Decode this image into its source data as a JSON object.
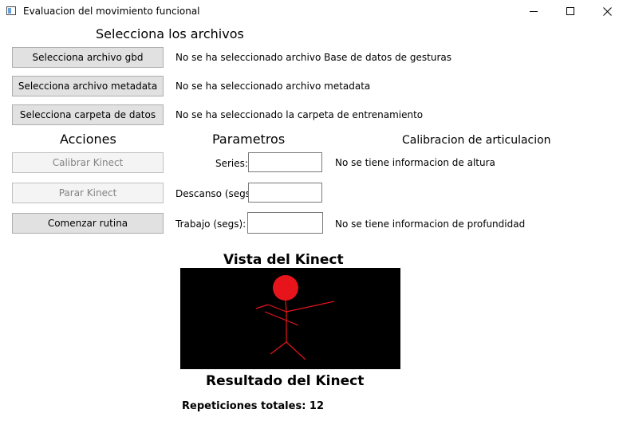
{
  "window": {
    "title": "Evaluacion del movimiento funcional"
  },
  "files": {
    "heading": "Selecciona los archivos",
    "gbd_button": "Selecciona archivo gbd",
    "gbd_status": "No se ha seleccionado archivo Base de datos de gesturas",
    "metadata_button": "Selecciona archivo metadata",
    "metadata_status": "No se ha seleccionado archivo metadata",
    "folder_button": "Selecciona carpeta de datos",
    "folder_status": "No se ha seleccionado la carpeta de entrenamiento"
  },
  "actions": {
    "heading": "Acciones",
    "calibrate_button": "Calibrar Kinect",
    "stop_button": "Parar Kinect",
    "start_button": "Comenzar rutina"
  },
  "params": {
    "heading": "Parametros",
    "series_label": "Series:",
    "series_value": "",
    "rest_label": "Descanso (segs)",
    "rest_value": "",
    "work_label": "Trabajo (segs):",
    "work_value": ""
  },
  "calibration": {
    "heading": "Calibracion de articulacion",
    "height_status": "No se tiene informacion de altura",
    "depth_status": "No se tiene informacion de profundidad"
  },
  "kinect": {
    "view_heading": "Vista del Kinect",
    "result_heading": "Resultado del Kinect",
    "total_reps": "Repeticiones totales: 12",
    "skeleton_color": "#e8141c",
    "background_color": "#000000"
  }
}
